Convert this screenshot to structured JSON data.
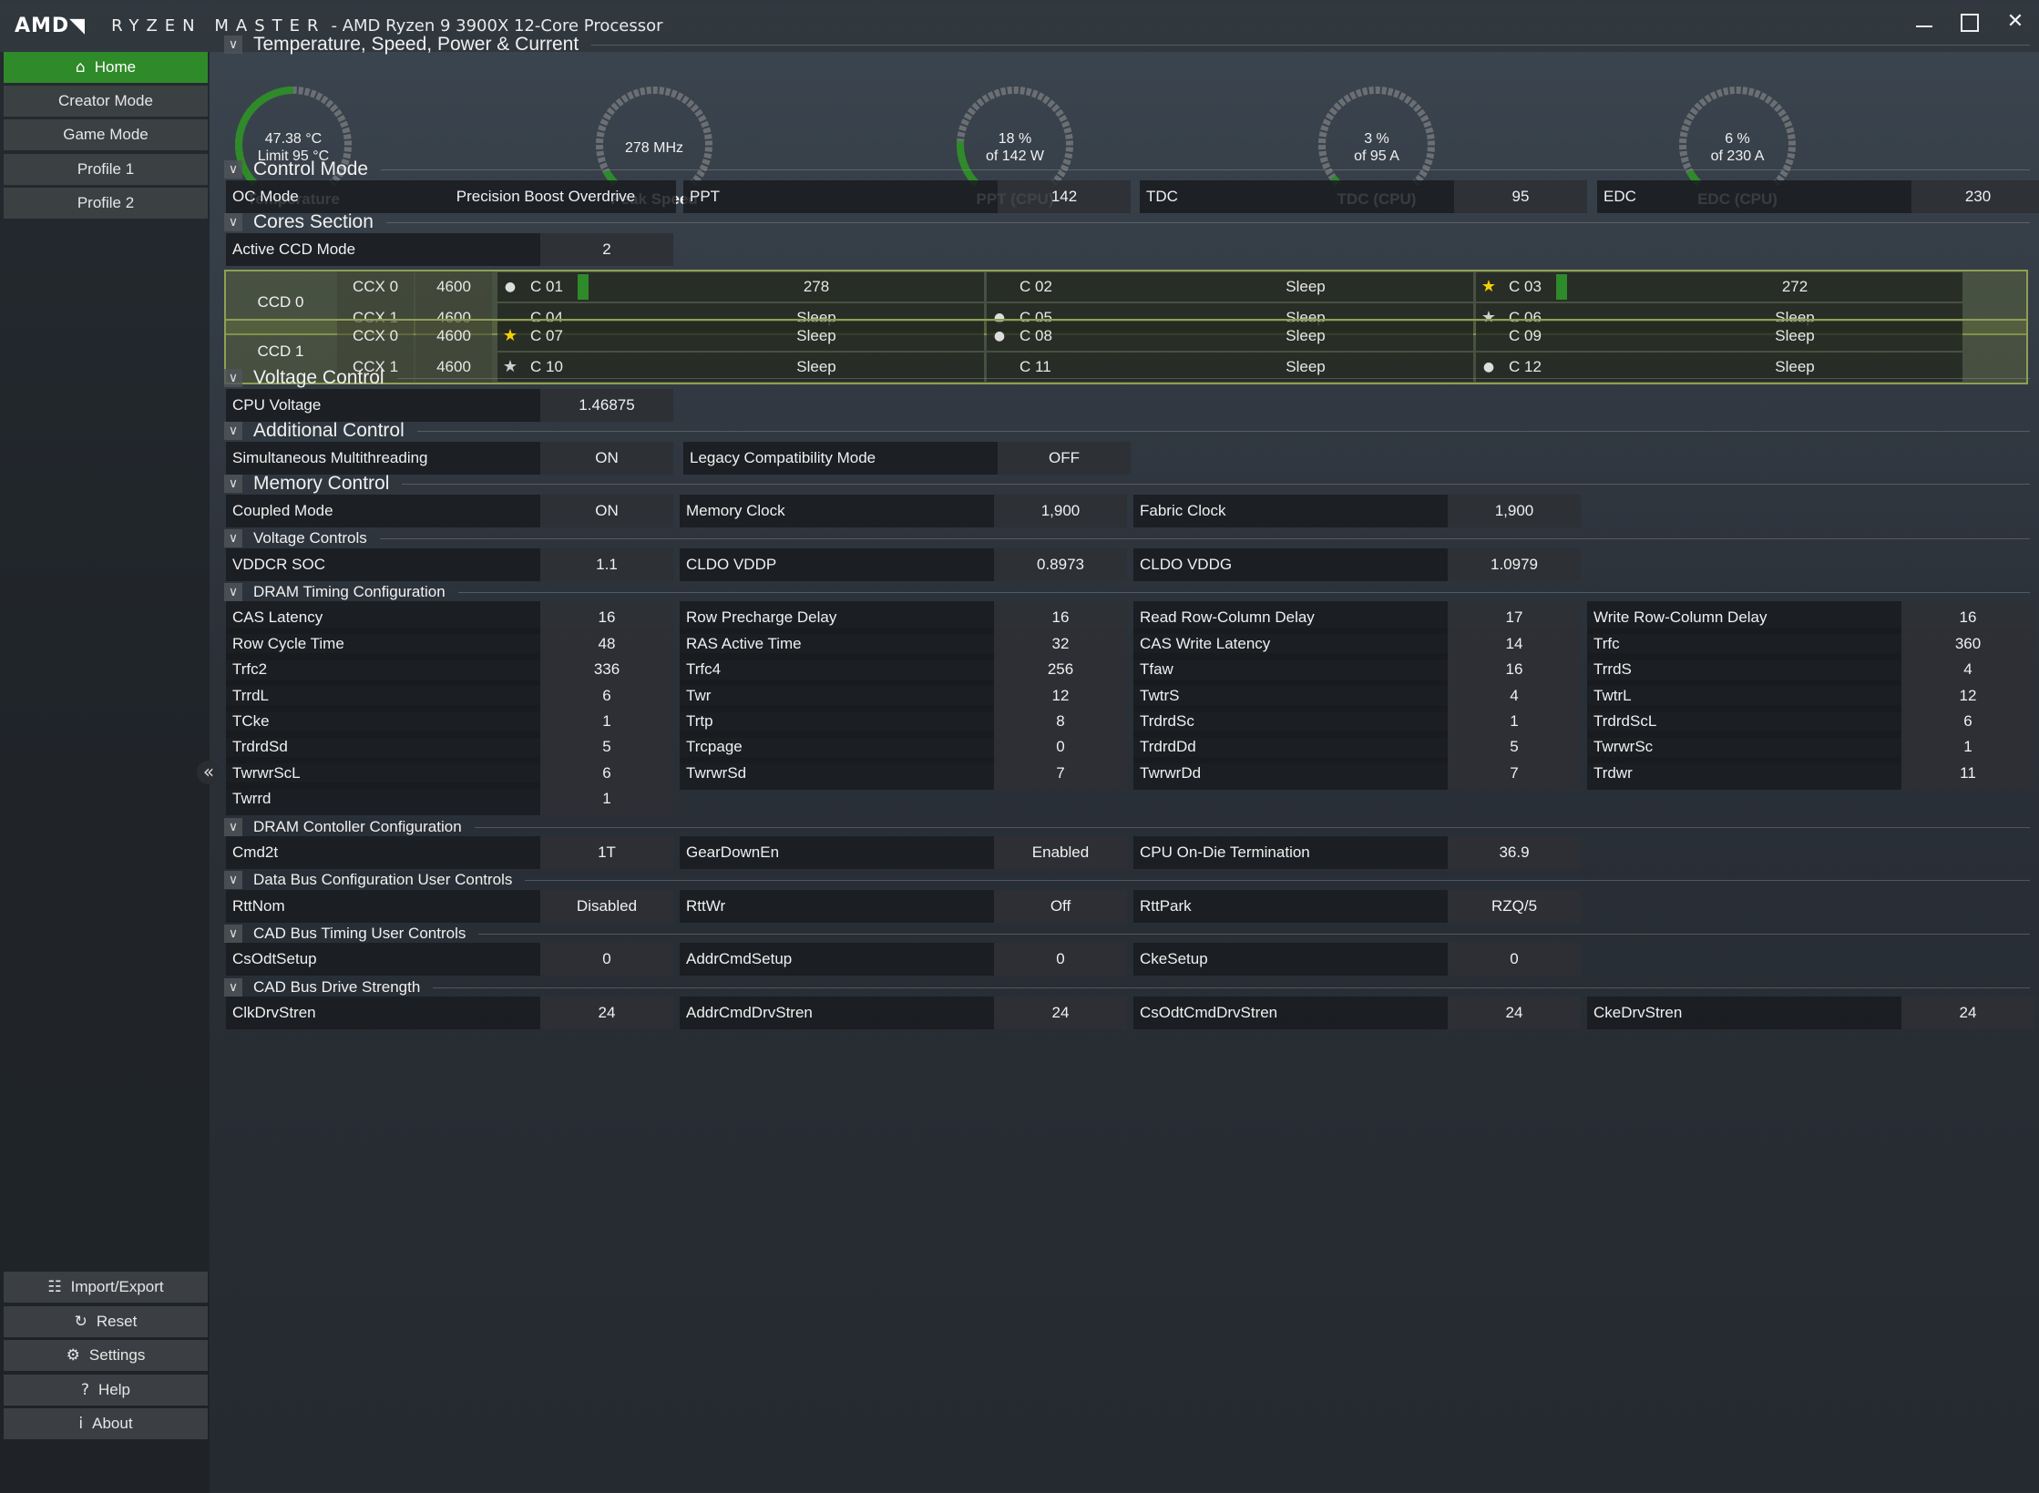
{
  "titlebar": {
    "logo": "AMD◥",
    "app": "RYZEN MASTER",
    "processor": "-  AMD Ryzen 9 3900X 12-Core Processor",
    "minimize": "",
    "maximize": "",
    "close": "✕"
  },
  "sidebar": {
    "top": [
      {
        "label": "Home",
        "icon": "home-icon",
        "active": true
      },
      {
        "label": "Creator Mode"
      },
      {
        "label": "Game Mode"
      },
      {
        "label": "Profile 1"
      },
      {
        "label": "Profile 2"
      }
    ],
    "bottom": [
      {
        "label": "Import/Export",
        "icon": "import-export-icon",
        "glyph": "☷"
      },
      {
        "label": "Reset",
        "icon": "reset-icon",
        "glyph": "↻"
      },
      {
        "label": "Settings",
        "icon": "settings-icon",
        "glyph": "⚙"
      },
      {
        "label": "Help",
        "icon": "help-icon",
        "glyph": "?"
      },
      {
        "label": "About",
        "icon": "about-icon",
        "glyph": "i"
      }
    ],
    "collapse_glyph": "«"
  },
  "sections": {
    "temp": "Temperature, Speed, Power & Current",
    "control": "Control Mode",
    "cores": "Cores Section",
    "voltage": "Voltage Control",
    "additional": "Additional Control",
    "memory": "Memory Control",
    "voltage_controls": "Voltage Controls",
    "dram_timing": "DRAM Timing Configuration",
    "dram_controller": "DRAM Contoller Configuration",
    "data_bus": "Data Bus Configuration User Controls",
    "cad_timing": "CAD Bus Timing User Controls",
    "cad_drive": "CAD Bus Drive Strength"
  },
  "gauges": [
    {
      "line1": "47.38 °C",
      "line2": "Limit 95 °C",
      "label": "Temperature",
      "fraction": 0.5
    },
    {
      "line1": "278  MHz",
      "line2": "",
      "label": "Peak Speed",
      "fraction": 0.06
    },
    {
      "line1": "18 %",
      "line2": "of 142 W",
      "label": "PPT (CPU)",
      "fraction": 0.18
    },
    {
      "line1": "3 %",
      "line2": "of 95 A",
      "label": "TDC (CPU)",
      "fraction": 0.03
    },
    {
      "line1": "6 %",
      "line2": "of 230 A",
      "label": "EDC (CPU)",
      "fraction": 0.06
    }
  ],
  "control_mode": {
    "oc_label": "OC Mode",
    "oc_value": "Precision Boost Overdrive",
    "ppt_label": "PPT",
    "ppt_value": "142",
    "tdc_label": "TDC",
    "tdc_value": "95",
    "edc_label": "EDC",
    "edc_value": "230"
  },
  "cores": {
    "active_ccd_label": "Active CCD Mode",
    "active_ccd_value": "2",
    "ccds": [
      {
        "name": "CCD 0",
        "ccx": [
          {
            "name": "CCX 0",
            "freq": "4600",
            "cores": [
              {
                "mark": "dot",
                "name": "C 01",
                "value": "278",
                "bar": true
              },
              {
                "mark": "",
                "name": "C 02",
                "value": "Sleep"
              },
              {
                "mark": "gold",
                "name": "C 03",
                "value": "272",
                "bar": true
              }
            ]
          },
          {
            "name": "CCX 1",
            "freq": "4600",
            "cores": [
              {
                "mark": "",
                "name": "C 04",
                "value": "Sleep"
              },
              {
                "mark": "dot",
                "name": "C 05",
                "value": "Sleep"
              },
              {
                "mark": "grey",
                "name": "C 06",
                "value": "Sleep"
              }
            ]
          }
        ]
      },
      {
        "name": "CCD 1",
        "ccx": [
          {
            "name": "CCX 0",
            "freq": "4600",
            "cores": [
              {
                "mark": "gold",
                "name": "C 07",
                "value": "Sleep"
              },
              {
                "mark": "dot",
                "name": "C 08",
                "value": "Sleep"
              },
              {
                "mark": "",
                "name": "C 09",
                "value": "Sleep"
              }
            ]
          },
          {
            "name": "CCX 1",
            "freq": "4600",
            "cores": [
              {
                "mark": "grey",
                "name": "C 10",
                "value": "Sleep"
              },
              {
                "mark": "",
                "name": "C 11",
                "value": "Sleep"
              },
              {
                "mark": "dot",
                "name": "C 12",
                "value": "Sleep"
              }
            ]
          }
        ]
      }
    ]
  },
  "voltage": {
    "label": "CPU Voltage",
    "value": "1.46875"
  },
  "additional": {
    "smt_label": "Simultaneous Multithreading",
    "smt_value": "ON",
    "legacy_label": "Legacy Compatibility Mode",
    "legacy_value": "OFF"
  },
  "memory": {
    "coupled_label": "Coupled Mode",
    "coupled_value": "ON",
    "memclk_label": "Memory Clock",
    "memclk_value": "1,900",
    "fclk_label": "Fabric Clock",
    "fclk_value": "1,900"
  },
  "voltage_controls": [
    {
      "label": "VDDCR SOC",
      "value": "1.1"
    },
    {
      "label": "CLDO VDDP",
      "value": "0.8973"
    },
    {
      "label": "CLDO VDDG",
      "value": "1.0979"
    }
  ],
  "dram_timing": [
    [
      {
        "label": "CAS Latency",
        "value": "16"
      },
      {
        "label": "Row Precharge Delay",
        "value": "16"
      },
      {
        "label": "Read Row-Column Delay",
        "value": "17"
      },
      {
        "label": "Write Row-Column Delay",
        "value": "16"
      }
    ],
    [
      {
        "label": "Row Cycle Time",
        "value": "48"
      },
      {
        "label": "RAS Active Time",
        "value": "32"
      },
      {
        "label": "CAS Write Latency",
        "value": "14"
      },
      {
        "label": "Trfc",
        "value": "360"
      }
    ],
    [
      {
        "label": "Trfc2",
        "value": "336"
      },
      {
        "label": "Trfc4",
        "value": "256"
      },
      {
        "label": "Tfaw",
        "value": "16"
      },
      {
        "label": "TrrdS",
        "value": "4"
      }
    ],
    [
      {
        "label": "TrrdL",
        "value": "6"
      },
      {
        "label": "Twr",
        "value": "12"
      },
      {
        "label": "TwtrS",
        "value": "4"
      },
      {
        "label": "TwtrL",
        "value": "12"
      }
    ],
    [
      {
        "label": "TCke",
        "value": "1"
      },
      {
        "label": "Trtp",
        "value": "8"
      },
      {
        "label": "TrdrdSc",
        "value": "1"
      },
      {
        "label": "TrdrdScL",
        "value": "6"
      }
    ],
    [
      {
        "label": "TrdrdSd",
        "value": "5"
      },
      {
        "label": "Trcpage",
        "value": "0"
      },
      {
        "label": "TrdrdDd",
        "value": "5"
      },
      {
        "label": "TwrwrSc",
        "value": "1"
      }
    ],
    [
      {
        "label": "TwrwrScL",
        "value": "6"
      },
      {
        "label": "TwrwrSd",
        "value": "7"
      },
      {
        "label": "TwrwrDd",
        "value": "7"
      },
      {
        "label": "Trdwr",
        "value": "11"
      }
    ],
    [
      {
        "label": "Twrrd",
        "value": "1"
      }
    ]
  ],
  "dram_controller": [
    {
      "label": "Cmd2t",
      "value": "1T"
    },
    {
      "label": "GearDownEn",
      "value": "Enabled"
    },
    {
      "label": "CPU On-Die Termination",
      "value": "36.9"
    }
  ],
  "data_bus": [
    {
      "label": "RttNom",
      "value": "Disabled"
    },
    {
      "label": "RttWr",
      "value": "Off"
    },
    {
      "label": "RttPark",
      "value": "RZQ/5"
    }
  ],
  "cad_timing": [
    {
      "label": "CsOdtSetup",
      "value": "0"
    },
    {
      "label": "AddrCmdSetup",
      "value": "0"
    },
    {
      "label": "CkeSetup",
      "value": "0"
    }
  ],
  "cad_drive": [
    {
      "label": "ClkDrvStren",
      "value": "24"
    },
    {
      "label": "AddrCmdDrvStren",
      "value": "24"
    },
    {
      "label": "CsOdtCmdDrvStren",
      "value": "24"
    },
    {
      "label": "CkeDrvStren",
      "value": "24"
    }
  ],
  "colors": {
    "accent": "#2f8a2a",
    "ccd_border": "#8f9f52",
    "star_gold": "#f5d000"
  }
}
